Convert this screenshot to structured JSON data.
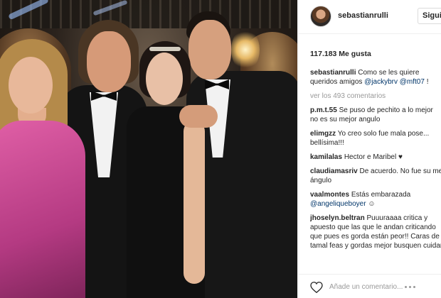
{
  "header": {
    "username": "sebastianrulli",
    "follow_label": "Siguiendo"
  },
  "likes": "117.183 Me gusta",
  "caption": {
    "user": "sebastianrulli",
    "line1": "Como se les quiere",
    "line2": "queridos amigos",
    "mention1": "@jackybrv",
    "mention2": "@mft07",
    "suffix": "!"
  },
  "view_all": "ver los 493 comentarios",
  "comments": [
    {
      "user": "p.m.t.55",
      "line1": "Se puso de pechito a lo mejor",
      "line2": "no es su mejor angulo"
    },
    {
      "user": "elimgzz",
      "line1": "Yo creo solo fue mala pose...",
      "line2": "bellísima!!!"
    },
    {
      "user": "kamilalas",
      "line1": "Hector e Maribel",
      "line2": ""
    },
    {
      "user": "claudiamasriv",
      "line1": "De acuerdo. No fue su mejor",
      "line2": "ángulo"
    },
    {
      "user": "vaalmontes",
      "line1": "Estás embarazada",
      "line2": "@angeliqueboyer"
    },
    {
      "user": "jhoselyn.beltran",
      "line1": "Puuuraaaa critica y",
      "line2": "apuesto que las que le andan criticando",
      "line3": "que pues es gorda están peor!! Caras de",
      "line4": "tamal feas y gordas mejor busquen cuidarse"
    }
  ],
  "add_comment_placeholder": "Añade un comentario...",
  "icons": {
    "heart": "heart-icon",
    "more": "more-options-icon",
    "emoji_heart": "black-heart-emoji",
    "emoji_face": "neutral-face-emoji"
  },
  "colors": {
    "text": "#262626",
    "muted": "#999999",
    "link": "#003569",
    "border": "#efefef"
  }
}
